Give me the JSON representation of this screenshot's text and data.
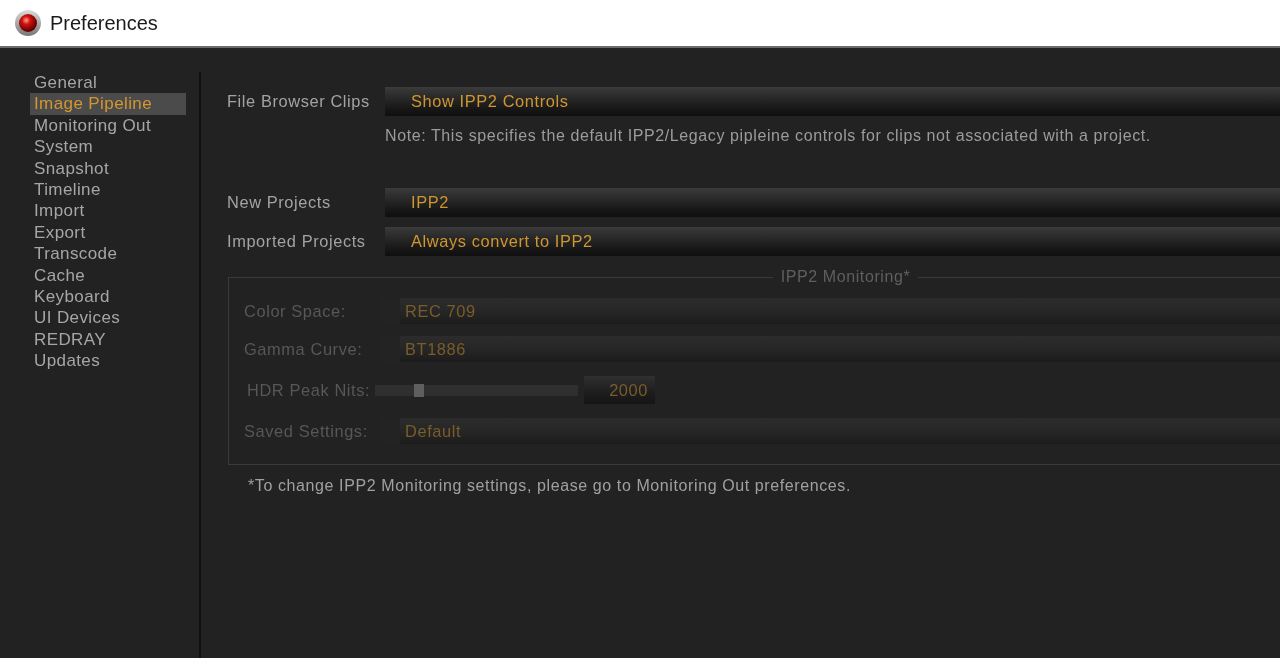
{
  "window": {
    "title": "Preferences"
  },
  "sidebar": {
    "items": [
      {
        "label": "General",
        "selected": false
      },
      {
        "label": "Image Pipeline",
        "selected": true
      },
      {
        "label": "Monitoring Out",
        "selected": false
      },
      {
        "label": "System",
        "selected": false
      },
      {
        "label": "Snapshot",
        "selected": false
      },
      {
        "label": "Timeline",
        "selected": false
      },
      {
        "label": "Import",
        "selected": false
      },
      {
        "label": "Export",
        "selected": false
      },
      {
        "label": "Transcode",
        "selected": false
      },
      {
        "label": "Cache",
        "selected": false
      },
      {
        "label": "Keyboard",
        "selected": false
      },
      {
        "label": "UI Devices",
        "selected": false
      },
      {
        "label": "REDRAY",
        "selected": false
      },
      {
        "label": "Updates",
        "selected": false
      }
    ]
  },
  "settings": [
    {
      "label": "File Browser Clips",
      "value": "Show IPP2 Controls",
      "note": "Note: This specifies the default IPP2/Legacy pipleine controls for clips not associated with a project."
    },
    {
      "label": "New Projects",
      "value": "IPP2"
    },
    {
      "label": "Imported Projects",
      "value": "Always convert to IPP2"
    }
  ],
  "monitoring": {
    "title": "IPP2 Monitoring*",
    "disabled": true,
    "rows": [
      {
        "kind": "dropdown",
        "label": "Color Space:",
        "value": "REC 709"
      },
      {
        "kind": "dropdown",
        "label": "Gamma Curve:",
        "value": "BT1886"
      },
      {
        "kind": "slider",
        "label": "HDR Peak Nits:",
        "level": 0.2,
        "value": "2000"
      },
      {
        "kind": "dropdown",
        "label": "Saved Settings:",
        "value": "Default"
      }
    ]
  },
  "footnote": "*To change IPP2 Monitoring settings, please go to Monitoring Out preferences."
}
